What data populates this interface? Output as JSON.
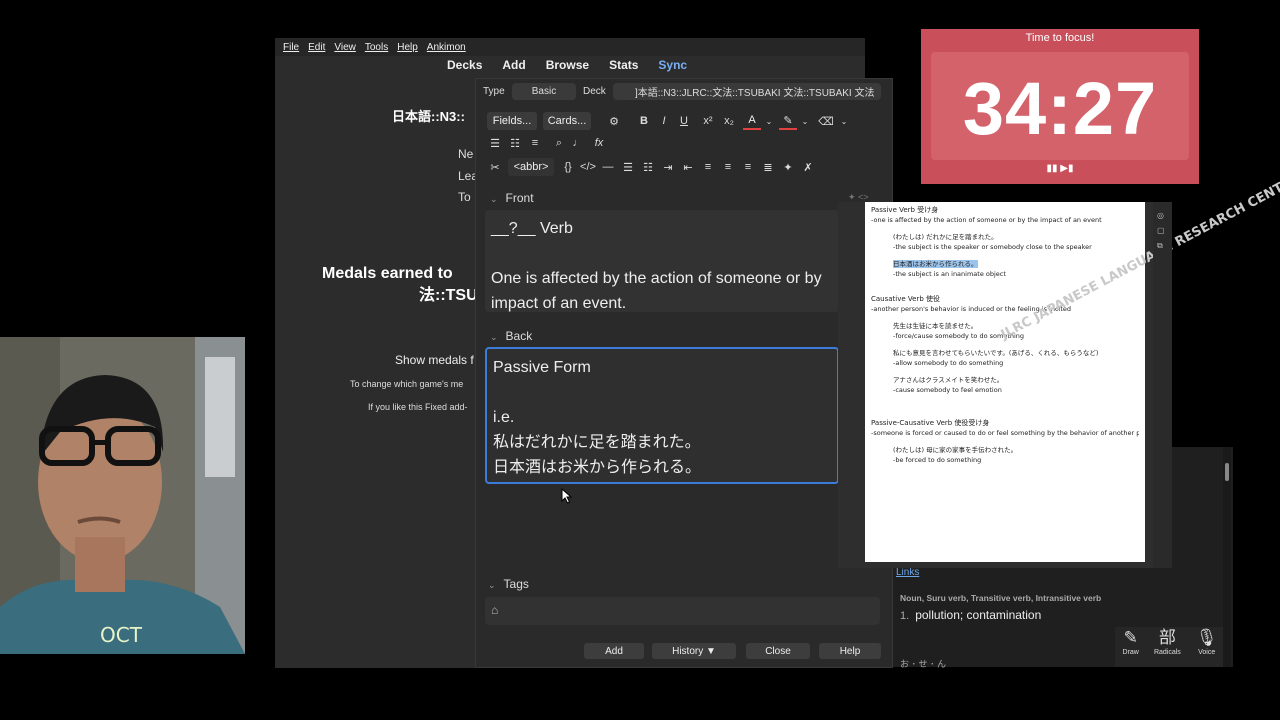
{
  "menu": [
    "File",
    "Edit",
    "View",
    "Tools",
    "Help",
    "Ankimon"
  ],
  "main_toolbar": {
    "decks": "Decks",
    "add": "Add",
    "browse": "Browse",
    "stats": "Stats",
    "sync": "Sync"
  },
  "overview": {
    "deck_title": "日本語::N3::",
    "new": "Ne",
    "learn": "Lea",
    "to_review": "To",
    "medals_line1": "Medals earned to",
    "medals_line2": "法::TSU",
    "show_medals": "Show medals f",
    "change_game": "To change which game's me",
    "like_addon": "If you like this Fixed add-"
  },
  "add_dialog": {
    "type_label": "Type",
    "type_value": "Basic",
    "deck_label": "Deck",
    "deck_value": "]本語::N3::JLRC::文法::TSUBAKI 文法::TSUBAKI 文法",
    "fields_button": "Fields...",
    "cards_button": "Cards...",
    "format_abbr": "<abbr>",
    "front_label": "Front",
    "front_text_1": "__?__ Verb",
    "front_text_2": "One is affected by the action of someone or by",
    "front_text_3": "impact of an event.",
    "back_label": "Back",
    "back_text_1": "Passive Form",
    "back_text_2": "i.e.",
    "back_text_3": "私はだれかに足を踏まれた。",
    "back_text_4": "日本酒はお米から作られる。",
    "tags_label": "Tags",
    "add_button": "Add",
    "history_button": "History ▼",
    "close_button": "Close",
    "help_button": "Help"
  },
  "timer": {
    "title": "Time to focus!",
    "value": "34:27",
    "controls": "▮▮ ▶▮"
  },
  "pdf": {
    "passive_title": "Passive Verb 受け身",
    "passive_desc": "-one is affected by the action of someone or by the impact of an event",
    "passive_ex1": "(わたしは) だれかに足を踏まれた。",
    "passive_ex1_desc": "-the subject is the speaker or somebody close to the speaker",
    "passive_ex2": "日本酒はお米から作られる。",
    "passive_ex2_desc": "-the subject is an inanimate object",
    "causative_title": "Causative Verb 使役",
    "causative_desc": "-another person's behavior is induced or the feeling is incited",
    "causative_ex1": "先生は生徒に本を読ませた。",
    "causative_ex1_desc": "-force/cause somebody to do something",
    "causative_ex2": "私にも意見を言わせてもらいたいです。(あげる、くれる、もらうなど)",
    "causative_ex2_desc": "-allow somebody to do something",
    "causative_ex3": "アナさんはクラスメイトを笑わせた。",
    "causative_ex3_desc": "-cause somebody to feel emotion",
    "pc_title": "Passive-Causative Verb 使役受け身",
    "pc_desc": "-someone is forced or caused to do or feel something by the behavior of another p",
    "pc_ex1": "(わたしは) 母に家の家事を手伝わされた。",
    "pc_ex1_desc": "-be forced to do something",
    "watermark": "JLRC JAPANESE LANGUAGE RESEARCH CENTER"
  },
  "dictionary": {
    "links": "Links",
    "pos": "Noun, Suru verb, Transitive verb, Intransitive verb",
    "def_num": "1.",
    "definition": "pollution; contamination",
    "tools": [
      {
        "icon": "✎",
        "label": "Draw"
      },
      {
        "icon": "部",
        "label": "Radicals"
      },
      {
        "icon": "🎙",
        "label": "Voice"
      }
    ]
  }
}
